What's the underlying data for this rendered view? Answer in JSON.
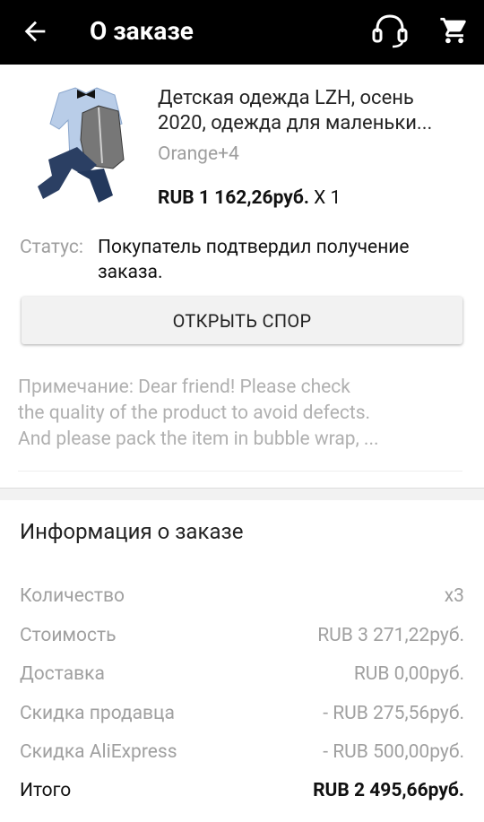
{
  "header": {
    "title": "О заказе",
    "back_icon": "arrow-left-icon",
    "support_icon": "headset-icon",
    "cart_icon": "cart-icon"
  },
  "product": {
    "title": "Детская одежда LZH, осень 2020, одежда для маленьки...",
    "title_line1": "Детская одежда LZH, осень",
    "title_line2": "2020, одежда для маленьки...",
    "variant": "Orange+4",
    "price": "RUB 1 162,26руб.",
    "quantity": "X 1"
  },
  "status": {
    "label": "Статус:",
    "text": "Покупатель подтвердил получение заказа."
  },
  "dispute_button": "ОТКРЫТЬ СПОР",
  "note": {
    "label": "Примечание:",
    "line1": " Dear friend! Please check",
    "line2": "the quality of the product to avoid defects.",
    "line3": "And please pack the item in bubble wrap, ..."
  },
  "order_info": {
    "title": "Информация о заказе",
    "rows": [
      {
        "label": "Количество",
        "value": "x3"
      },
      {
        "label": "Стоимость",
        "value": "RUB 3 271,22руб."
      },
      {
        "label": "Доставка",
        "value": "RUB 0,00руб."
      },
      {
        "label": "Скидка продавца",
        "value": "- RUB 275,56руб."
      },
      {
        "label": "Скидка AliExpress",
        "value": "- RUB 500,00руб."
      },
      {
        "label": "Итого",
        "value": "RUB 2 495,66руб."
      }
    ]
  }
}
